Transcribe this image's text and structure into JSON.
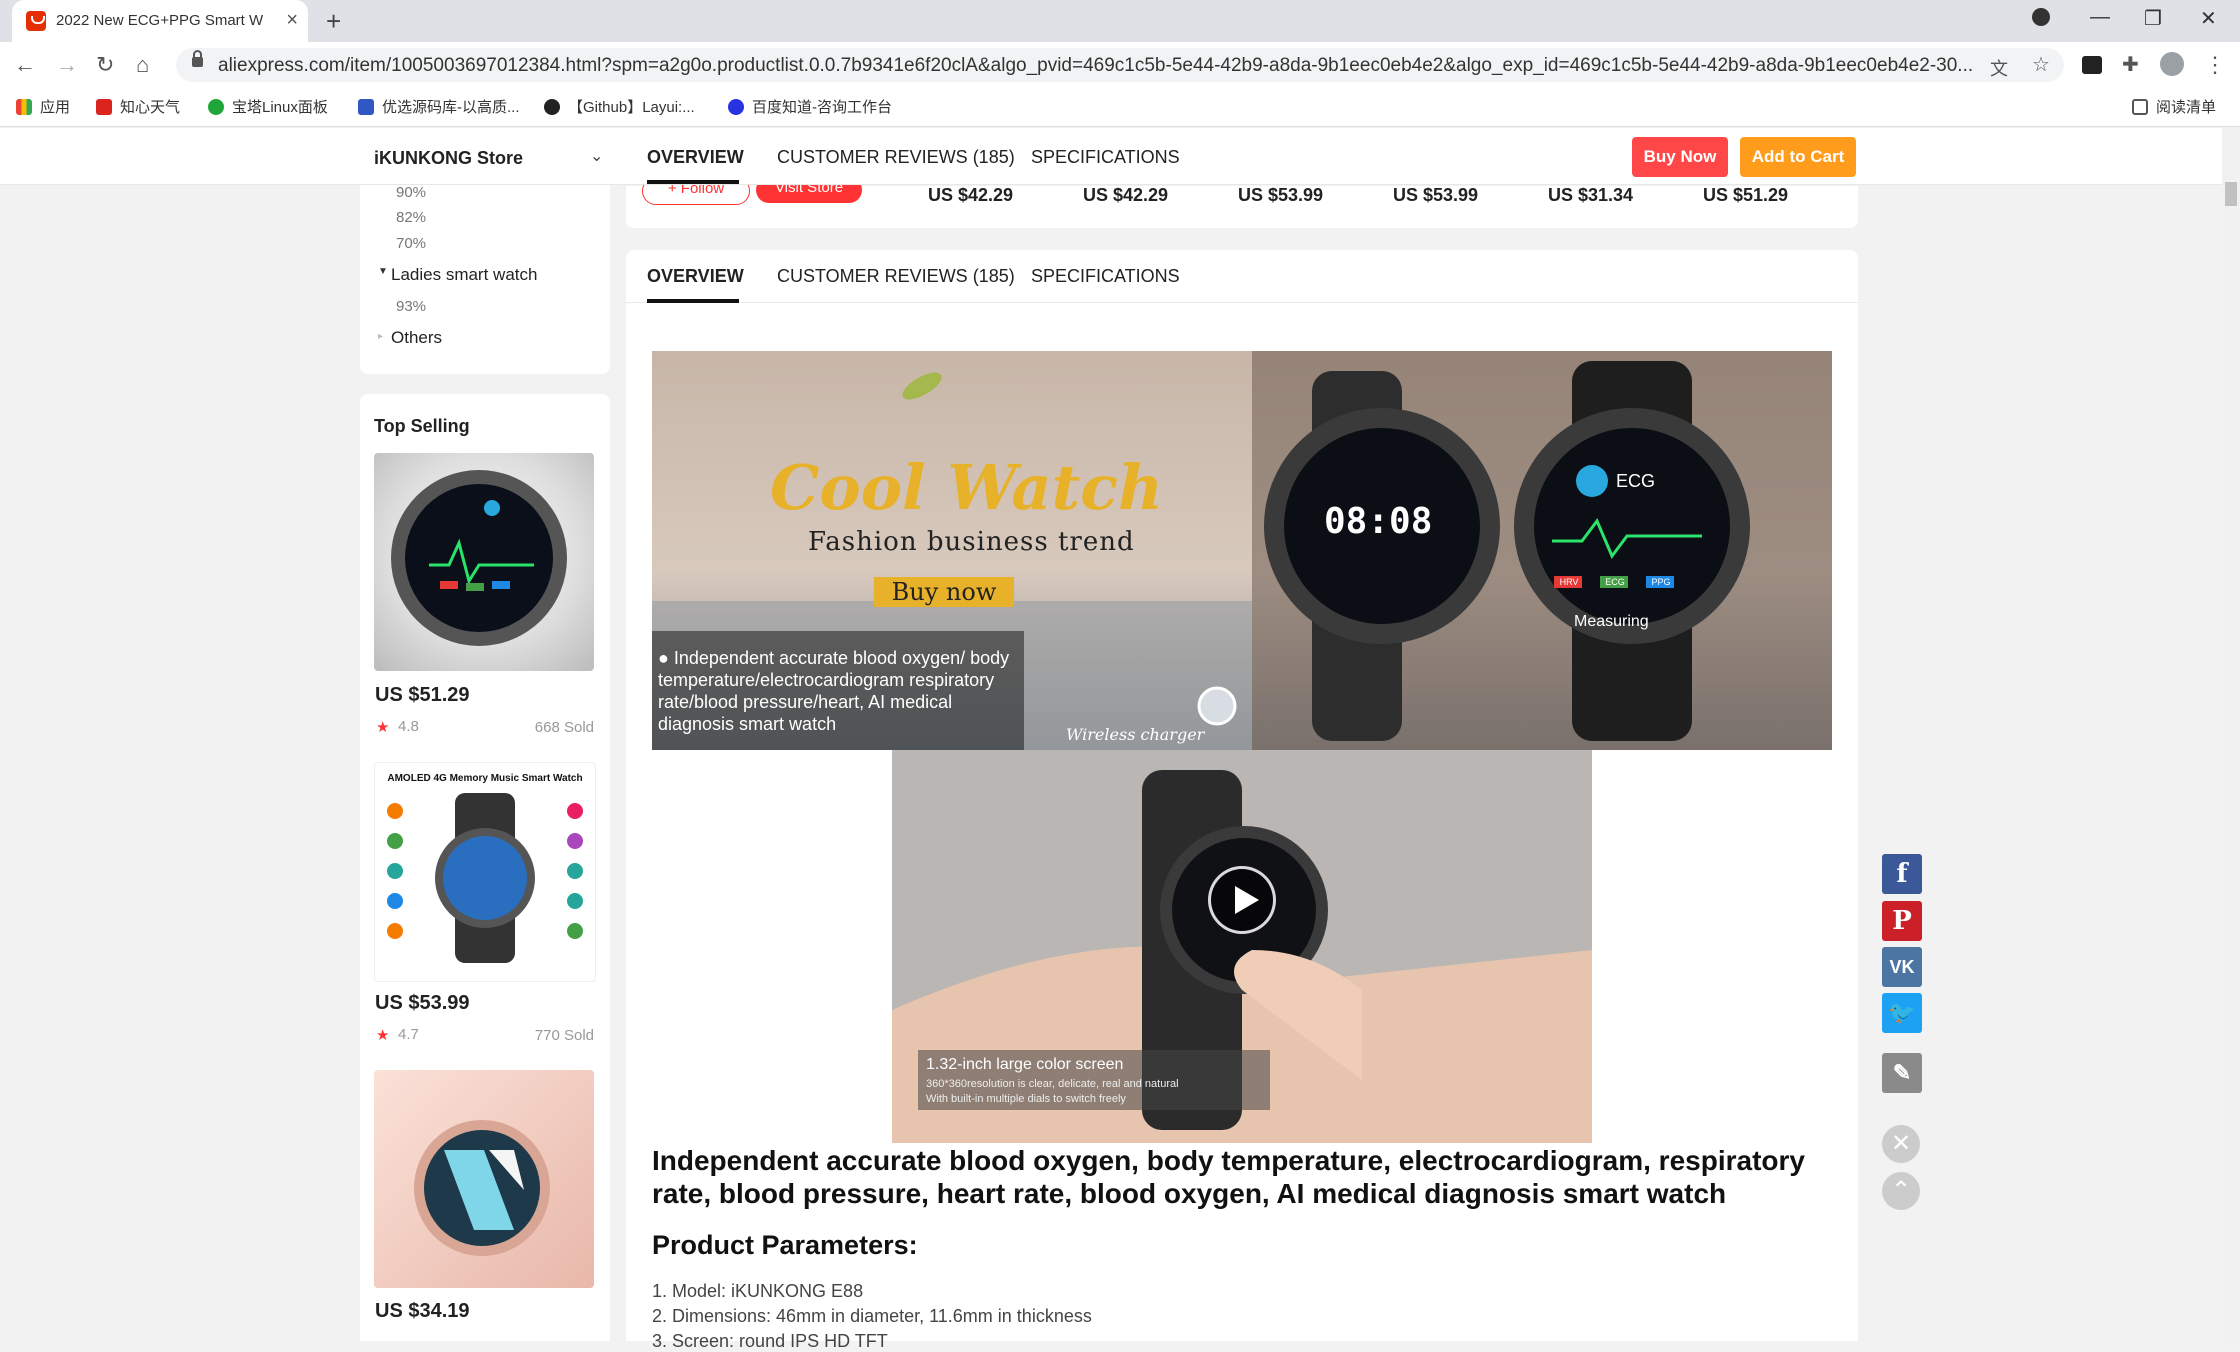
{
  "browser": {
    "tab_title": "2022 New ECG+PPG Smart W",
    "url": "aliexpress.com/item/1005003697012384.html?spm=a2g0o.productlist.0.0.7b9341e6f20clA&algo_pvid=469c1c5b-5e44-42b9-a8da-9b1eec0eb4e2&algo_exp_id=469c1c5b-5e44-42b9-a8da-9b1eec0eb4e2-30...",
    "bookmarks": [
      "应用",
      "知心天气",
      "宝塔Linux面板",
      "优选源码库-以高质...",
      "【Github】Layui:...",
      "百度知道-咨询工作台"
    ],
    "reading_list": "阅读清单"
  },
  "header": {
    "store_name": "iKUNKONG Store",
    "tabs": [
      "OVERVIEW",
      "CUSTOMER REVIEWS (185)",
      "SPECIFICATIONS"
    ],
    "buy_now": "Buy Now",
    "add_to_cart": "Add to Cart"
  },
  "sidebar": {
    "percentages_a": [
      "90%",
      "82%",
      "70%"
    ],
    "category": "Ladies smart watch",
    "percentage_b": "93%",
    "others": "Others",
    "top_selling_title": "Top Selling",
    "products": [
      {
        "price": "US $51.29",
        "rating": "4.8",
        "sold": "668 Sold"
      },
      {
        "price": "US $53.99",
        "rating": "4.7",
        "sold": "770 Sold"
      },
      {
        "price": "US $34.19"
      }
    ],
    "thumb2_title": "AMOLED 4G Memory Music Smart Watch"
  },
  "store_strip": {
    "follow": "+ Follow",
    "visit": "Visit Store",
    "prices": [
      "US $42.29",
      "US $42.29",
      "US $53.99",
      "US $53.99",
      "US $31.34",
      "US $51.29"
    ]
  },
  "banner": {
    "brand_art": "Cool Watch",
    "tagline": "Fashion business trend",
    "cta": "Buy now",
    "bullet": "Independent accurate blood oxygen/ body temperature/electrocardiogram respiratory rate/blood pressure/heart, AI medical diagnosis smart watch",
    "charger": "Wireless charger",
    "watch_time": "08:08",
    "ecg_label": "ECG",
    "hrv": "HRV",
    "ecg": "ECG",
    "ppg": "PPG",
    "measuring": "Measuring"
  },
  "video": {
    "caption_title": "1.32-inch large color screen",
    "caption_line1": "360*360resolution is clear, delicate, real and natural",
    "caption_line2": "With built-in multiple dials to switch freely"
  },
  "content": {
    "headline": "Independent accurate blood oxygen, body temperature, electrocardiogram, respiratory rate, blood pressure, heart rate, blood oxygen, AI medical diagnosis smart watch",
    "params_title": "Product Parameters:",
    "params": [
      "1. Model: iKUNKONG E88",
      "2. Dimensions: 46mm in diameter, 11.6mm in thickness",
      "3. Screen: round IPS HD TFT"
    ]
  },
  "colors": {
    "buy": "#ff4747",
    "cart": "#ff9c1b",
    "facebook": "#3b5998",
    "pinterest": "#cb2027",
    "vk": "#4c75a3",
    "twitter": "#1da1f2"
  }
}
